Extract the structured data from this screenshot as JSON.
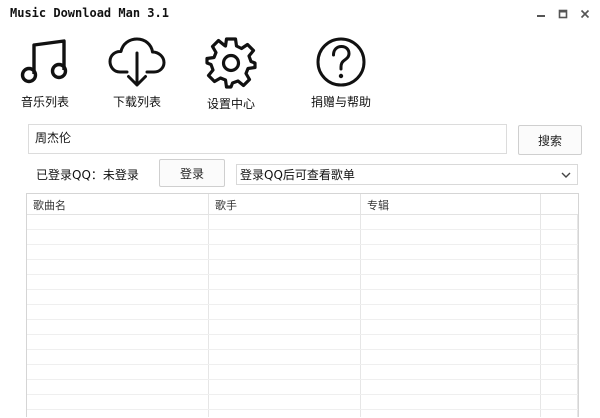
{
  "window": {
    "title": "Music Download Man 3.1",
    "controls": [
      "minimize-icon",
      "maximize-icon",
      "close-icon"
    ]
  },
  "toolbar": [
    {
      "icon": "music-note-icon",
      "label": "音乐列表"
    },
    {
      "icon": "cloud-download-icon",
      "label": "下载列表"
    },
    {
      "icon": "gear-icon",
      "label": "设置中心"
    },
    {
      "icon": "question-mark-icon",
      "label": "捐赠与帮助"
    }
  ],
  "search": {
    "value": "周杰伦",
    "button_label": "搜索"
  },
  "login": {
    "status_text": "已登录QQ：未登录",
    "button_label": "登录"
  },
  "playlist_select": {
    "selected": "登录QQ后可查看歌单",
    "icon": "chevron-down-icon"
  },
  "table": {
    "columns": [
      "歌曲名",
      "歌手",
      "专辑",
      ""
    ],
    "rows": []
  }
}
